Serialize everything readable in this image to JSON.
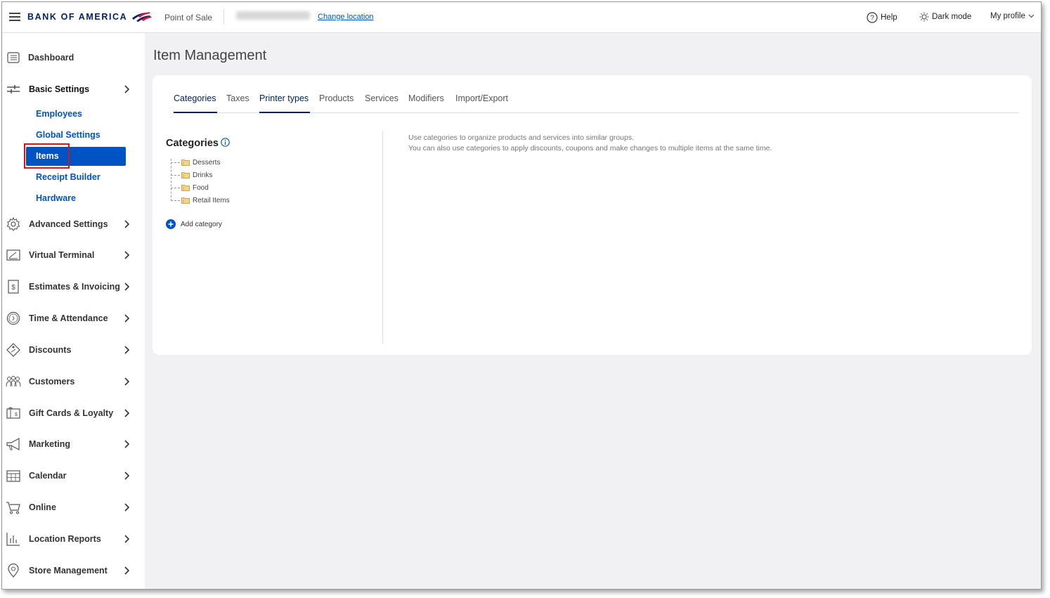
{
  "header": {
    "brand": "BANK OF AMERICA",
    "app_name": "Point of Sale",
    "change_location": "Change location",
    "help": "Help",
    "dark_mode": "Dark mode",
    "my_profile": "My profile"
  },
  "sidebar": {
    "items": [
      {
        "label": "Dashboard",
        "icon": "dashboard-icon"
      },
      {
        "label": "Basic Settings",
        "icon": "sliders-icon"
      },
      {
        "label": "Advanced Settings",
        "icon": "gear-icon"
      },
      {
        "label": "Virtual Terminal",
        "icon": "terminal-icon"
      },
      {
        "label": "Estimates & Invoicing",
        "icon": "invoice-icon"
      },
      {
        "label": "Time & Attendance",
        "icon": "clock-icon"
      },
      {
        "label": "Discounts",
        "icon": "tag-icon"
      },
      {
        "label": "Customers",
        "icon": "people-icon"
      },
      {
        "label": "Gift Cards & Loyalty",
        "icon": "gift-card-icon"
      },
      {
        "label": "Marketing",
        "icon": "megaphone-icon"
      },
      {
        "label": "Calendar",
        "icon": "calendar-icon"
      },
      {
        "label": "Online",
        "icon": "cart-icon"
      },
      {
        "label": "Location Reports",
        "icon": "bar-chart-icon"
      },
      {
        "label": "Store Management",
        "icon": "location-pin-icon"
      }
    ],
    "basic_settings_sub": {
      "employees": "Employees",
      "global_settings": "Global Settings",
      "items": "Items",
      "receipt_builder": "Receipt Builder",
      "hardware": "Hardware"
    }
  },
  "main": {
    "page_title": "Item Management",
    "tabs": [
      {
        "label": "Categories"
      },
      {
        "label": "Taxes"
      },
      {
        "label": "Printer types"
      },
      {
        "label": "Products"
      },
      {
        "label": "Services"
      },
      {
        "label": "Modifiers"
      },
      {
        "label": "Import/Export"
      }
    ],
    "categories_title": "Categories",
    "categories": [
      "Desserts",
      "Drinks",
      "Food",
      "Retail Items"
    ],
    "add_category": "Add category",
    "description_line1": "Use categories to organize products and services into similar groups.",
    "description_line2": "You can also use categories to apply discounts, coupons and make changes to multiple items at the same time."
  },
  "colors": {
    "brand_navy": "#012169",
    "brand_red": "#e31837",
    "link_blue": "#0053c2",
    "highlight_red": "#d1161d"
  }
}
